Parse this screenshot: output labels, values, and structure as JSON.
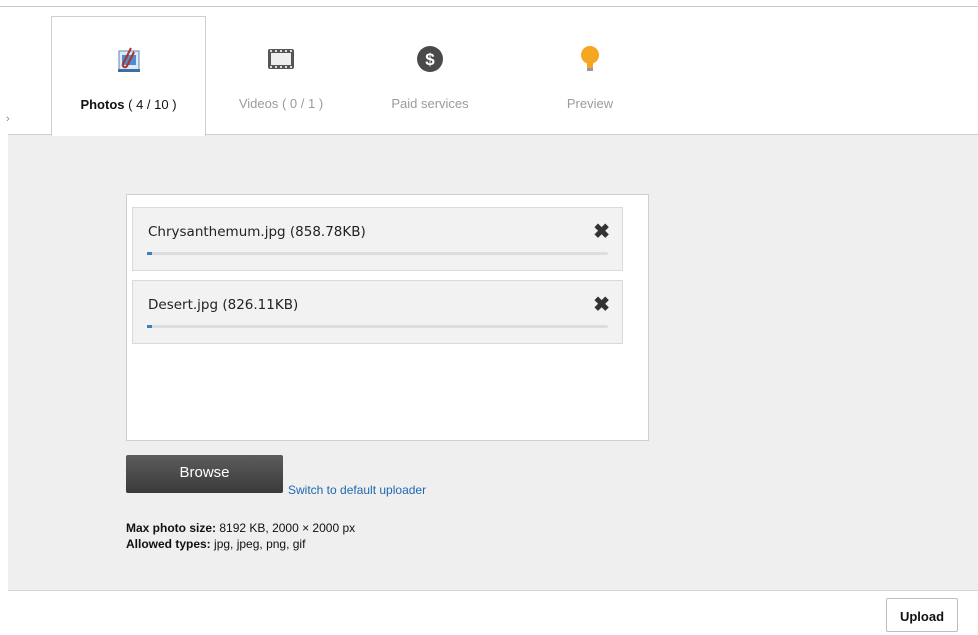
{
  "tabs": [
    {
      "label": "Photos",
      "count": "( 4 / 10 )",
      "icon": "photo-paperclip-icon",
      "active": true
    },
    {
      "label": "Videos ( 0 / 1 )",
      "icon": "film-strip-icon",
      "active": false
    },
    {
      "label": "Paid services",
      "icon": "dollar-coin-icon",
      "active": false
    },
    {
      "label": "Preview",
      "icon": "lightbulb-icon",
      "active": false
    }
  ],
  "uploader": {
    "files": [
      {
        "name": "Chrysanthemum.jpg (858.78KB)",
        "progress": 0.01
      },
      {
        "name": "Desert.jpg (826.11KB)",
        "progress": 0.01
      }
    ],
    "remove_symbol": "✖",
    "browse_label": "Browse",
    "switch_label": "Switch to default uploader"
  },
  "info": {
    "max_label": "Max photo size:",
    "max_value": "8192 KB, 2000 × 2000 px",
    "types_label": "Allowed types:",
    "types_value": "jpg, jpeg, png, gif"
  },
  "footer": {
    "upload_label": "Upload"
  },
  "colors": {
    "progress": "#3a7fc4",
    "link": "#1e67b0",
    "coin": "#4a4a4a",
    "bulb": "#f5a623"
  }
}
